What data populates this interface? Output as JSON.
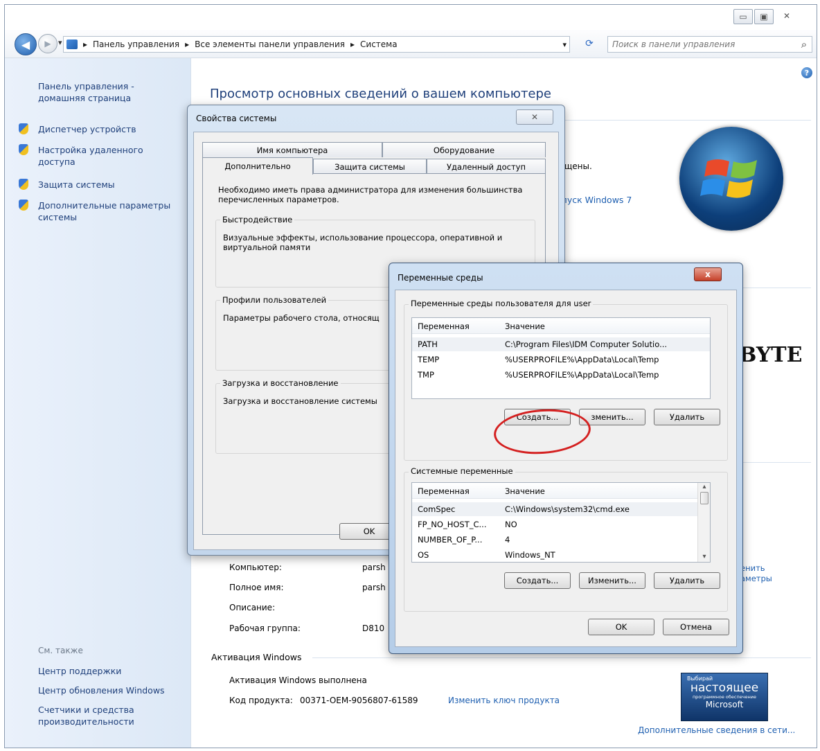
{
  "window": {
    "minimize": "▭",
    "maximize": "▣",
    "close": "✕"
  },
  "nav": {
    "back_icon": "◀",
    "forward_icon": "▶",
    "drop": "▾"
  },
  "address": {
    "crumbs": [
      "Панель управления",
      "Все элементы панели управления",
      "Система"
    ],
    "separator": "▸",
    "refresh_icon": "⟳"
  },
  "search": {
    "placeholder": "Поиск в панели управления",
    "icon": "⌕"
  },
  "help_icon": "?",
  "sidebar": {
    "home": "Панель управления - домашняя страница",
    "items": [
      "Диспетчер устройств",
      "Настройка удаленного доступа",
      "Защита системы",
      "Дополнительные параметры системы"
    ],
    "see_also": "См. также",
    "see_also_items": [
      "Центр поддержки",
      "Центр обновления Windows",
      "Счетчики и средства производительности"
    ]
  },
  "main": {
    "heading": "Просмотр основных сведений о вашем компьютере",
    "reserved": "щены.",
    "win7link": "апуск Windows 7",
    "brand": "BYTE",
    "computer_rows": [
      {
        "label": "Компьютер:",
        "value": "parsh"
      },
      {
        "label": "Полное имя:",
        "value": "parsh"
      },
      {
        "label": "Описание:",
        "value": ""
      },
      {
        "label": "Рабочая группа:",
        "value": "D810"
      }
    ],
    "change_link": [
      "енить",
      "аметры"
    ],
    "activation_title": "Активация Windows",
    "activation_status": "Активация Windows выполнена",
    "product_key_label": "Код продукта:",
    "product_key": "00371-OEM-9056807-61589",
    "change_key": "Изменить ключ продукта",
    "badge": {
      "small": "Выбирай",
      "big": "настоящее",
      "sub": "программное обеспечение",
      "brand": "Microsoft"
    },
    "more_info": "Дополнительные сведения в сети..."
  },
  "sysprops": {
    "title": "Свойства системы",
    "close": "✕",
    "tabs_top": [
      "Имя компьютера",
      "Оборудование"
    ],
    "tabs_bottom": [
      "Дополнительно",
      "Защита системы",
      "Удаленный доступ"
    ],
    "admin_note": "Необходимо иметь права администратора для изменения большинства перечисленных параметров.",
    "groups": [
      {
        "title": "Быстродействие",
        "text": "Визуальные эффекты, использование процессора, оперативной и виртуальной памяти"
      },
      {
        "title": "Профили пользователей",
        "text": "Параметры рабочего стола, относящ"
      },
      {
        "title": "Загрузка и восстановление",
        "text": "Загрузка и восстановление системы"
      }
    ],
    "ok": "OK"
  },
  "envvars": {
    "title": "Переменные среды",
    "close": "x",
    "user_group": "Переменные среды пользователя для user",
    "col_var": "Переменная",
    "col_val": "Значение",
    "user_vars": [
      {
        "name": "PATH",
        "value": "C:\\Program Files\\IDM Computer Solutio..."
      },
      {
        "name": "TEMP",
        "value": "%USERPROFILE%\\AppData\\Local\\Temp"
      },
      {
        "name": "TMP",
        "value": "%USERPROFILE%\\AppData\\Local\\Temp"
      }
    ],
    "sys_group": "Системные переменные",
    "sys_vars": [
      {
        "name": "ComSpec",
        "value": "C:\\Windows\\system32\\cmd.exe"
      },
      {
        "name": "FP_NO_HOST_C...",
        "value": "NO"
      },
      {
        "name": "NUMBER_OF_P...",
        "value": "4"
      },
      {
        "name": "OS",
        "value": "Windows_NT"
      }
    ],
    "btn_new": "Создать...",
    "btn_edit": "Изменить...",
    "btn_edit_partial": "зменить...",
    "btn_delete": "Удалить",
    "ok": "OK",
    "cancel": "Отмена",
    "scroll_up": "▴",
    "scroll_down": "▾"
  },
  "accent": {
    "link": "#1e5fb0",
    "heading": "#1e3f7a",
    "annotation": "#d42020"
  }
}
